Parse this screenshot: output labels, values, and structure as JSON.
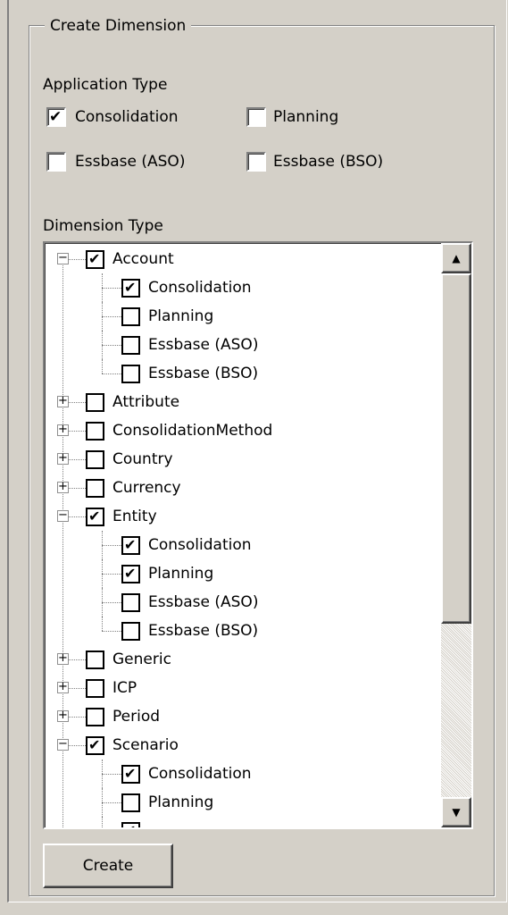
{
  "group": {
    "title": "Create Dimension"
  },
  "application_type": {
    "label": "Application Type",
    "options": [
      {
        "label": "Consolidation",
        "checked": true
      },
      {
        "label": "Planning",
        "checked": false
      },
      {
        "label": "Essbase (ASO)",
        "checked": false
      },
      {
        "label": "Essbase (BSO)",
        "checked": false
      }
    ]
  },
  "dimension_type": {
    "label": "Dimension Type",
    "tree": [
      {
        "label": "Account",
        "level": 0,
        "expander": "minus",
        "checked": true
      },
      {
        "label": "Consolidation",
        "level": 1,
        "checked": true
      },
      {
        "label": "Planning",
        "level": 1,
        "checked": false
      },
      {
        "label": "Essbase (ASO)",
        "level": 1,
        "checked": false
      },
      {
        "label": "Essbase (BSO)",
        "level": 1,
        "checked": false
      },
      {
        "label": "Attribute",
        "level": 0,
        "expander": "plus",
        "checked": false
      },
      {
        "label": "ConsolidationMethod",
        "level": 0,
        "expander": "plus",
        "checked": false
      },
      {
        "label": "Country",
        "level": 0,
        "expander": "plus",
        "checked": false
      },
      {
        "label": "Currency",
        "level": 0,
        "expander": "plus",
        "checked": false
      },
      {
        "label": "Entity",
        "level": 0,
        "expander": "minus",
        "checked": true
      },
      {
        "label": "Consolidation",
        "level": 1,
        "checked": true
      },
      {
        "label": "Planning",
        "level": 1,
        "checked": true
      },
      {
        "label": "Essbase (ASO)",
        "level": 1,
        "checked": false
      },
      {
        "label": "Essbase (BSO)",
        "level": 1,
        "checked": false
      },
      {
        "label": "Generic",
        "level": 0,
        "expander": "plus",
        "checked": false
      },
      {
        "label": "ICP",
        "level": 0,
        "expander": "plus",
        "checked": false
      },
      {
        "label": "Period",
        "level": 0,
        "expander": "plus",
        "checked": false
      },
      {
        "label": "Scenario",
        "level": 0,
        "expander": "minus",
        "checked": true
      },
      {
        "label": "Consolidation",
        "level": 1,
        "checked": true
      },
      {
        "label": "Planning",
        "level": 1,
        "checked": false
      },
      {
        "label": "",
        "level": 1,
        "checked": true
      }
    ]
  },
  "create_button": {
    "label": "Create"
  },
  "icons": {
    "check": "✔",
    "plus": "+",
    "minus": "−",
    "up_arrow": "▲",
    "down_arrow": "▼"
  }
}
